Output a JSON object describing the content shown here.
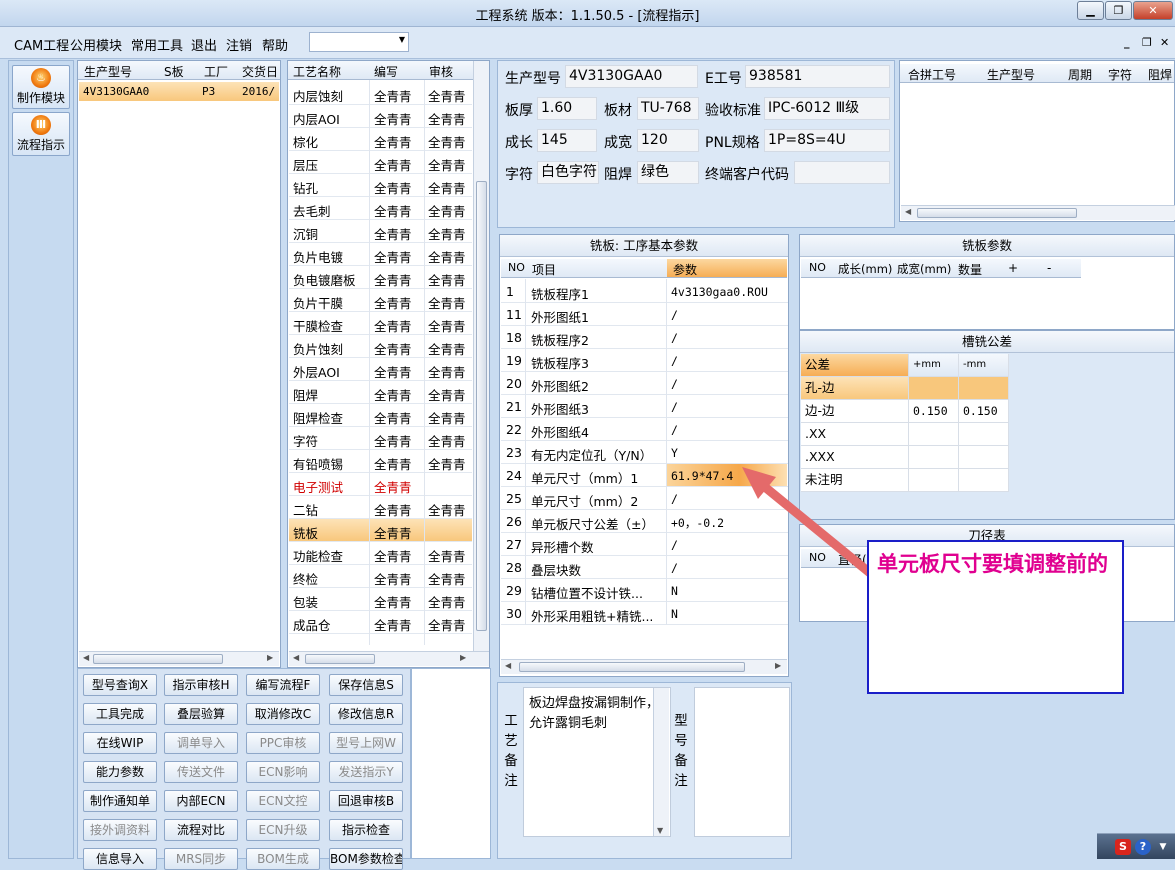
{
  "window": {
    "title": "工程系统   版本：1.1.50.5 - [流程指示]"
  },
  "menu": {
    "items": [
      "CAM工程",
      "公用模块",
      "常用工具",
      "退出",
      "注销",
      "帮助"
    ]
  },
  "nav": {
    "make_module": "制作模块",
    "flow_guide": "流程指示"
  },
  "product_grid": {
    "headers": [
      "生产型号",
      "S板",
      "工厂",
      "交货日"
    ],
    "rows": [
      {
        "model": "4V3130GAA0",
        "s": "",
        "factory": "P3",
        "date": "2016/"
      }
    ]
  },
  "process_grid": {
    "headers": [
      "工艺名称",
      "编写",
      "审核"
    ],
    "rows": [
      {
        "name": "内层蚀刻",
        "write": "全青青",
        "review": "全青青"
      },
      {
        "name": "内层AOI",
        "write": "全青青",
        "review": "全青青"
      },
      {
        "name": "棕化",
        "write": "全青青",
        "review": "全青青"
      },
      {
        "name": "层压",
        "write": "全青青",
        "review": "全青青"
      },
      {
        "name": "钻孔",
        "write": "全青青",
        "review": "全青青"
      },
      {
        "name": "去毛刺",
        "write": "全青青",
        "review": "全青青"
      },
      {
        "name": "沉铜",
        "write": "全青青",
        "review": "全青青"
      },
      {
        "name": "负片电镀",
        "write": "全青青",
        "review": "全青青"
      },
      {
        "name": "负电镀磨板",
        "write": "全青青",
        "review": "全青青"
      },
      {
        "name": "负片干膜",
        "write": "全青青",
        "review": "全青青"
      },
      {
        "name": "干膜检查",
        "write": "全青青",
        "review": "全青青"
      },
      {
        "name": "负片蚀刻",
        "write": "全青青",
        "review": "全青青"
      },
      {
        "name": "外层AOI",
        "write": "全青青",
        "review": "全青青"
      },
      {
        "name": "阻焊",
        "write": "全青青",
        "review": "全青青"
      },
      {
        "name": "阻焊检查",
        "write": "全青青",
        "review": "全青青"
      },
      {
        "name": "字符",
        "write": "全青青",
        "review": "全青青"
      },
      {
        "name": "有铅喷锡",
        "write": "全青青",
        "review": "全青青"
      },
      {
        "name": "电子测试",
        "write": "全青青",
        "review": ""
      },
      {
        "name": "二钻",
        "write": "全青青",
        "review": "全青青"
      },
      {
        "name": "铣板",
        "write": "全青青",
        "review": ""
      },
      {
        "name": "功能检查",
        "write": "全青青",
        "review": "全青青"
      },
      {
        "name": "终检",
        "write": "全青青",
        "review": "全青青"
      },
      {
        "name": "包装",
        "write": "全青青",
        "review": "全青青"
      },
      {
        "name": "成品仓",
        "write": "全青青",
        "review": "全青青"
      }
    ]
  },
  "actions": [
    {
      "label": "型号查询X",
      "enabled": true
    },
    {
      "label": "指示审核H",
      "enabled": true
    },
    {
      "label": "编写流程F",
      "enabled": true
    },
    {
      "label": "保存信息S",
      "enabled": true
    },
    {
      "label": "工具完成",
      "enabled": true
    },
    {
      "label": "叠层验算",
      "enabled": true
    },
    {
      "label": "取消修改C",
      "enabled": true
    },
    {
      "label": "修改信息R",
      "enabled": true
    },
    {
      "label": "在线WIP",
      "enabled": true
    },
    {
      "label": "调单导入",
      "enabled": false
    },
    {
      "label": "PPC审核",
      "enabled": false
    },
    {
      "label": "型号上网W",
      "enabled": false
    },
    {
      "label": "能力参数",
      "enabled": true
    },
    {
      "label": "传送文件",
      "enabled": false
    },
    {
      "label": "ECN影响",
      "enabled": false
    },
    {
      "label": "发送指示Y",
      "enabled": false
    },
    {
      "label": "制作通知单",
      "enabled": true
    },
    {
      "label": "内部ECN",
      "enabled": true
    },
    {
      "label": "ECN文控",
      "enabled": false
    },
    {
      "label": "回退审核B",
      "enabled": true
    },
    {
      "label": "接外调资料",
      "enabled": false
    },
    {
      "label": "流程对比",
      "enabled": true
    },
    {
      "label": "ECN升级",
      "enabled": false
    },
    {
      "label": "指示检查",
      "enabled": true
    },
    {
      "label": "信息导入",
      "enabled": true
    },
    {
      "label": "MRS同步",
      "enabled": false
    },
    {
      "label": "BOM生成",
      "enabled": false
    },
    {
      "label": "BOM参数检查",
      "enabled": true
    }
  ],
  "info": {
    "model_label": "生产型号",
    "model": "4V3130GAA0",
    "e_label": "E工号",
    "e_no": "938581",
    "thick_label": "板厚",
    "thick": "1.60",
    "material_label": "板材",
    "material": "TU-768",
    "std_label": "验收标准",
    "std": "IPC-6012 Ⅲ级",
    "len_label": "成长",
    "len": "145",
    "wid_label": "成宽",
    "wid": "120",
    "pnl_label": "PNL规格",
    "pnl": "1P=8S=4U",
    "char_label": "字符",
    "char": "白色字符",
    "mask_label": "阻焊",
    "mask": "绿色",
    "cust_label": "终端客户代码",
    "cust": ""
  },
  "merge_grid": {
    "headers": [
      "合拼工号",
      "生产型号",
      "周期",
      "字符",
      "阻焊"
    ]
  },
  "mill": {
    "caption": "铣板: 工序基本参数",
    "headers": [
      "NO",
      "项目",
      "参数"
    ],
    "rows": [
      {
        "no": "1",
        "item": "铣板程序1",
        "value": "4v3130gaa0.ROU"
      },
      {
        "no": "11",
        "item": "外形图纸1",
        "value": "/"
      },
      {
        "no": "18",
        "item": "铣板程序2",
        "value": "/"
      },
      {
        "no": "19",
        "item": "铣板程序3",
        "value": "/"
      },
      {
        "no": "20",
        "item": "外形图纸2",
        "value": "/"
      },
      {
        "no": "21",
        "item": "外形图纸3",
        "value": "/"
      },
      {
        "no": "22",
        "item": "外形图纸4",
        "value": "/"
      },
      {
        "no": "23",
        "item": "有无内定位孔（Y/N）",
        "value": "Y"
      },
      {
        "no": "24",
        "item": "单元尺寸（mm）1",
        "value": "61.9*47.4"
      },
      {
        "no": "25",
        "item": "单元尺寸（mm）2",
        "value": "/"
      },
      {
        "no": "26",
        "item": "单元板尺寸公差（±）",
        "value": "+0，-0.2"
      },
      {
        "no": "27",
        "item": "异形槽个数",
        "value": "/"
      },
      {
        "no": "28",
        "item": "叠层块数",
        "value": "/"
      },
      {
        "no": "29",
        "item": "钻槽位置不设计铁...",
        "value": "N"
      },
      {
        "no": "30",
        "item": "外形采用粗铣+精铣...",
        "value": "N"
      }
    ]
  },
  "notes": {
    "process_label": "工艺备注",
    "process_text": "板边焊盘按漏铜制作，允许露铜毛刺",
    "model_label": "型号备注"
  },
  "mill_params": {
    "caption": "铣板参数",
    "headers": [
      "NO",
      "成长(mm)",
      "成宽(mm)",
      "数量",
      "+",
      "-"
    ]
  },
  "slot": {
    "caption": "槽铣公差",
    "headers": [
      "公差",
      "+mm",
      "-mm"
    ],
    "rows": [
      {
        "name": "孔-边",
        "plus": "",
        "minus": ""
      },
      {
        "name": "边-边",
        "plus": "0.150",
        "minus": "0.150"
      },
      {
        "name": ".XX",
        "plus": "",
        "minus": ""
      },
      {
        "name": ".XXX",
        "plus": "",
        "minus": ""
      },
      {
        "name": "未注明",
        "plus": "",
        "minus": ""
      }
    ]
  },
  "tools": {
    "caption": "刀径表",
    "headers": [
      "NO",
      "直径("
    ]
  },
  "annotation": {
    "text": "单元板尺寸要填调整前的",
    "color": "#e00090",
    "border": "#1a1ec8",
    "arrow": "#e46a6a"
  }
}
